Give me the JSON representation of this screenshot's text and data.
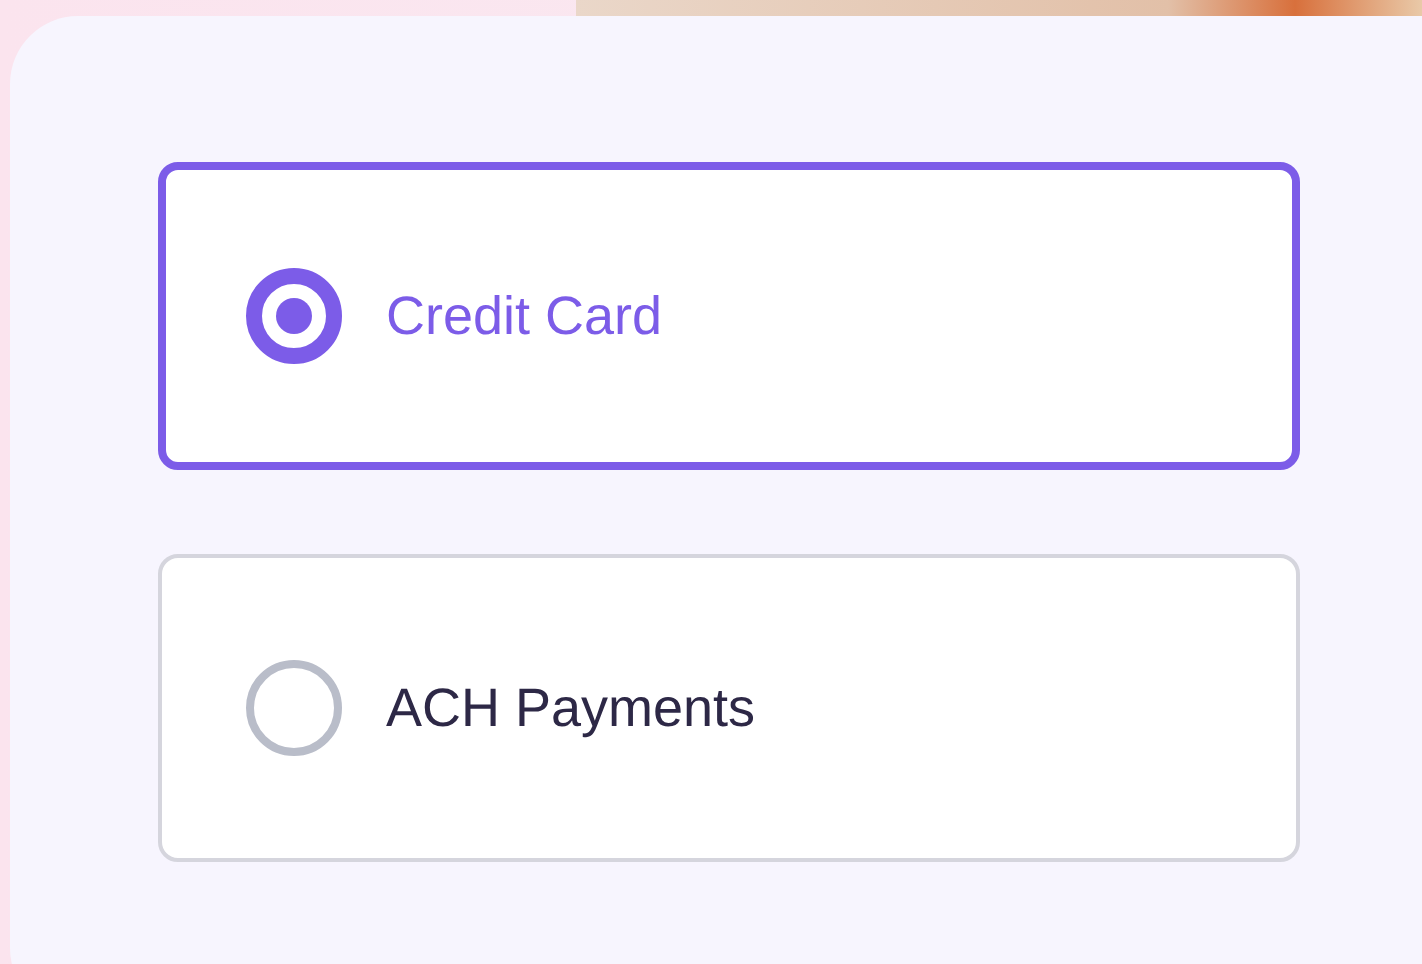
{
  "payment_options": [
    {
      "label": "Credit Card",
      "selected": true
    },
    {
      "label": "ACH Payments",
      "selected": false
    }
  ]
}
